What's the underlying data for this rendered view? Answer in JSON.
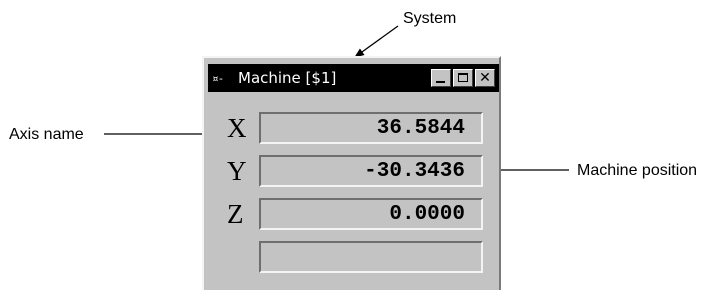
{
  "callouts": {
    "system": "System",
    "axis_name": "Axis name",
    "machine_position": "Machine position"
  },
  "window": {
    "system_icon": "¤-",
    "title": "Machine [$1]",
    "buttons": [
      "minimize",
      "maximize",
      "close"
    ],
    "close_glyph": "✕"
  },
  "axes": [
    {
      "name": "X",
      "value": "36.5844"
    },
    {
      "name": "Y",
      "value": "-30.3436"
    },
    {
      "name": "Z",
      "value": "0.0000"
    },
    {
      "name": "",
      "value": ""
    }
  ],
  "colors": {
    "window_face": "#c3c3c3",
    "titlebar": "#000000",
    "title_text": "#ffffff"
  }
}
